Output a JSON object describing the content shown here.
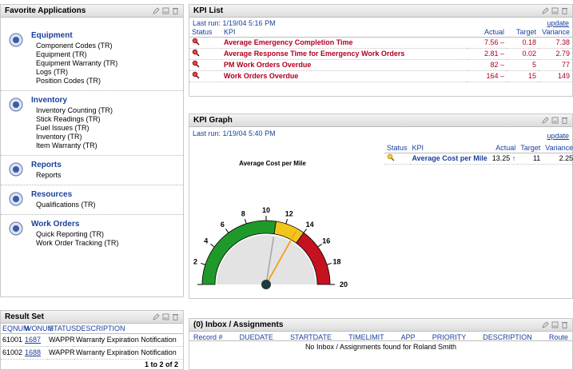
{
  "favorites": {
    "title": "Favorite Applications",
    "sections": [
      {
        "title": "Equipment",
        "icon": "equipment-icon",
        "items": [
          "Component Codes (TR)",
          "Equipment (TR)",
          "Equipment Warranty (TR)",
          "Logs (TR)",
          "Position Codes (TR)"
        ]
      },
      {
        "title": "Inventory",
        "icon": "inventory-icon",
        "items": [
          "Inventory Counting (TR)",
          "Stick Readings (TR)",
          "Fuel Issues (TR)",
          "Inventory (TR)",
          "Item Warranty (TR)"
        ]
      },
      {
        "title": "Reports",
        "icon": "reports-icon",
        "items": [
          "Reports"
        ]
      },
      {
        "title": "Resources",
        "icon": "resources-icon",
        "items": [
          "Qualifications (TR)"
        ]
      },
      {
        "title": "Work Orders",
        "icon": "work-orders-icon",
        "items": [
          "Quick Reporting (TR)",
          "Work Order Tracking (TR)"
        ]
      }
    ]
  },
  "kpi_list": {
    "title": "KPI List",
    "last_run": "Last run: 1/19/04 5:16 PM",
    "update": "update",
    "headers": {
      "status": "Status",
      "kpi": "KPI",
      "actual": "Actual",
      "target": "Target",
      "variance": "Variance"
    },
    "rows": [
      {
        "kpi": "Average Emergency Completion Time",
        "actual": "7.56",
        "trend": "–",
        "target": "0.18",
        "variance": "7.38"
      },
      {
        "kpi": "Average Response Time for Emergency Work Orders",
        "actual": "2.81",
        "trend": "–",
        "target": "0.02",
        "variance": "2.79"
      },
      {
        "kpi": "PM Work Orders Overdue",
        "actual": "82",
        "trend": "–",
        "target": "5",
        "variance": "77"
      },
      {
        "kpi": "Work Orders Overdue",
        "actual": "164",
        "trend": "–",
        "target": "15",
        "variance": "149"
      }
    ]
  },
  "kpi_graph": {
    "title": "KPI Graph",
    "last_run": "Last run: 1/19/04 5:40 PM",
    "update": "update",
    "gauge_title": "Average Cost per Mile",
    "headers": {
      "status": "Status",
      "kpi": "KPI",
      "actual": "Actual",
      "target": "Target",
      "variance": "Variance"
    },
    "row": {
      "kpi": "Average Cost per Mile",
      "actual": "13.25",
      "trend": "↑",
      "target": "11",
      "variance": "2.25"
    }
  },
  "chart_data": {
    "type": "gauge",
    "title": "Average Cost per Mile",
    "min": 0,
    "max": 20,
    "ticks": [
      "0",
      "2",
      "4",
      "6",
      "8",
      "10",
      "12",
      "14",
      "16",
      "18",
      "20"
    ],
    "value": 13.25,
    "target": 11,
    "bands": [
      {
        "from": 0,
        "to": 11,
        "color": "#1f9a2a"
      },
      {
        "from": 11,
        "to": 14,
        "color": "#f2c51c"
      },
      {
        "from": 14,
        "to": 20,
        "color": "#c4121f"
      }
    ],
    "colors": {
      "value_needle": "#f5a01a",
      "target_needle": "#a8a8a8",
      "face": "#e3e3e3"
    }
  },
  "result_set": {
    "title": "Result Set",
    "headers": [
      "EQNUM",
      "WONUM",
      "STATUS",
      "DESCRIPTION"
    ],
    "rows": [
      {
        "eqnum": "61001",
        "wonum": "1687",
        "status": "WAPPR",
        "description": "Warranty Expiration Notification"
      },
      {
        "eqnum": "61002",
        "wonum": "1688",
        "status": "WAPPR",
        "description": "Warranty Expiration Notification"
      }
    ],
    "footer": "1 to 2 of 2"
  },
  "inbox": {
    "title": "(0) Inbox / Assignments",
    "headers": [
      "Record #",
      "DUEDATE",
      "STARTDATE",
      "TIMELIMIT",
      "APP",
      "PRIORITY",
      "DESCRIPTION",
      "Route"
    ],
    "empty_message": "No Inbox / Assignments found for Roland Smith"
  }
}
